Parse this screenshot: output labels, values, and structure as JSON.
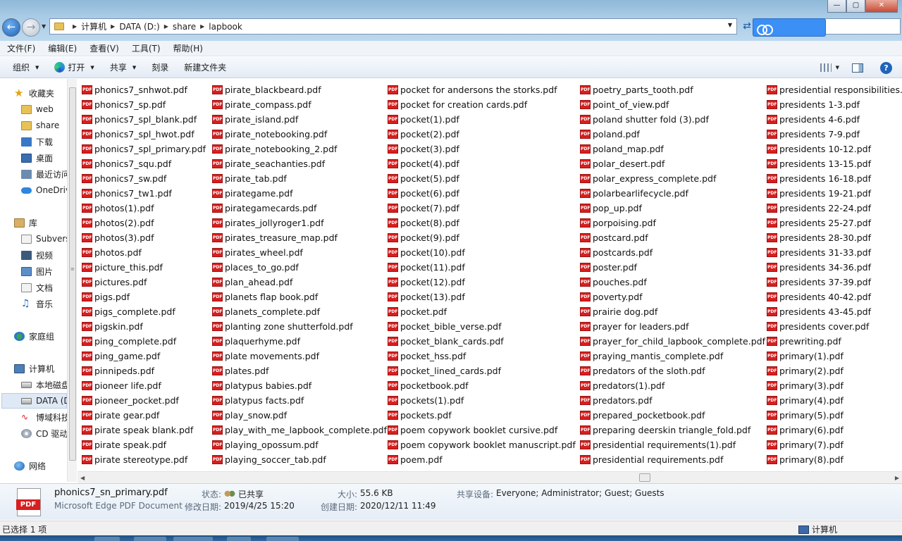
{
  "window": {
    "controls": [
      "—",
      "▢",
      "✕"
    ]
  },
  "address": {
    "crumbs": [
      "计算机",
      "DATA (D:)",
      "share",
      "lapbook"
    ]
  },
  "menu": [
    "文件(F)",
    "编辑(E)",
    "查看(V)",
    "工具(T)",
    "帮助(H)"
  ],
  "toolbar": {
    "organize": "组织",
    "open": "打开",
    "share": "共享",
    "burn": "刻录",
    "new_folder": "新建文件夹"
  },
  "nav": {
    "favorites": "收藏夹",
    "web": "web",
    "share": "share",
    "downloads": "下载",
    "desktop": "桌面",
    "recent": "最近访问",
    "onedrive": "OneDrive",
    "libraries": "库",
    "subversion": "Subversion",
    "videos": "视频",
    "pictures": "图片",
    "documents": "文档",
    "music": "音乐",
    "homegroup": "家庭组",
    "computer": "计算机",
    "local_disk": "本地磁盘",
    "data_drive": "DATA (D:)",
    "bowei": "博域科技",
    "cd_drive": "CD 驱动器",
    "network": "网络"
  },
  "icons": {
    "pdf": "PDF"
  },
  "files": {
    "col1": [
      "phonics7_snhwot.pdf",
      "phonics7_sp.pdf",
      "phonics7_spl_blank.pdf",
      "phonics7_spl_hwot.pdf",
      "phonics7_spl_primary.pdf",
      "phonics7_squ.pdf",
      "phonics7_sw.pdf",
      "phonics7_tw1.pdf",
      "photos(1).pdf",
      "photos(2).pdf",
      "photos(3).pdf",
      "photos.pdf",
      "picture_this.pdf",
      "pictures.pdf",
      "pigs.pdf",
      "pigs_complete.pdf",
      "pigskin.pdf",
      "ping_complete.pdf",
      "ping_game.pdf",
      "pinnipeds.pdf",
      "pioneer life.pdf",
      "pioneer_pocket.pdf",
      "pirate gear.pdf",
      "pirate speak blank.pdf",
      "pirate speak.pdf",
      "pirate stereotype.pdf"
    ],
    "col2": [
      "pirate_blackbeard.pdf",
      "pirate_compass.pdf",
      "pirate_island.pdf",
      "pirate_notebooking.pdf",
      "pirate_notebooking_2.pdf",
      "pirate_seachanties.pdf",
      "pirate_tab.pdf",
      "pirategame.pdf",
      "pirategamecards.pdf",
      "pirates_jollyroger1.pdf",
      "pirates_treasure_map.pdf",
      "pirates_wheel.pdf",
      "places_to_go.pdf",
      "plan_ahead.pdf",
      "planets flap book.pdf",
      "planets_complete.pdf",
      "planting zone shutterfold.pdf",
      "plaquerhyme.pdf",
      "plate movements.pdf",
      "plates.pdf",
      "platypus babies.pdf",
      "platypus facts.pdf",
      "play_snow.pdf",
      "play_with_me_lapbook_complete.pdf",
      "playing_opossum.pdf",
      "playing_soccer_tab.pdf"
    ],
    "col3": [
      "pocket for andersons the storks.pdf",
      "pocket for creation cards.pdf",
      "pocket(1).pdf",
      "pocket(2).pdf",
      "pocket(3).pdf",
      "pocket(4).pdf",
      "pocket(5).pdf",
      "pocket(6).pdf",
      "pocket(7).pdf",
      "pocket(8).pdf",
      "pocket(9).pdf",
      "pocket(10).pdf",
      "pocket(11).pdf",
      "pocket(12).pdf",
      "pocket(13).pdf",
      "pocket.pdf",
      "pocket_bible_verse.pdf",
      "pocket_blank_cards.pdf",
      "pocket_hss.pdf",
      "pocket_lined_cards.pdf",
      "pocketbook.pdf",
      "pockets(1).pdf",
      "pockets.pdf",
      "poem copywork booklet cursive.pdf",
      "poem copywork booklet manuscript.pdf",
      "poem.pdf"
    ],
    "col4": [
      "poetry_parts_tooth.pdf",
      "point_of_view.pdf",
      "poland shutter fold (3).pdf",
      "poland.pdf",
      "poland_map.pdf",
      "polar_desert.pdf",
      "polar_express_complete.pdf",
      "polarbearlifecycle.pdf",
      "pop_up.pdf",
      "porpoising.pdf",
      "postcard.pdf",
      "postcards.pdf",
      "poster.pdf",
      "pouches.pdf",
      "poverty.pdf",
      "prairie dog.pdf",
      "prayer for leaders.pdf",
      "prayer_for_child_lapbook_complete.pdf",
      "praying_mantis_complete.pdf",
      "predators of the sloth.pdf",
      "predators(1).pdf",
      "predators.pdf",
      "prepared_pocketbook.pdf",
      "preparing deerskin triangle_fold.pdf",
      "presidential requirements(1).pdf",
      "presidential requirements.pdf"
    ],
    "col5": [
      "presidential responsibilities.pdf",
      "presidents 1-3.pdf",
      "presidents 4-6.pdf",
      "presidents 7-9.pdf",
      "presidents 10-12.pdf",
      "presidents 13-15.pdf",
      "presidents 16-18.pdf",
      "presidents 19-21.pdf",
      "presidents 22-24.pdf",
      "presidents 25-27.pdf",
      "presidents 28-30.pdf",
      "presidents 31-33.pdf",
      "presidents 34-36.pdf",
      "presidents 37-39.pdf",
      "presidents 40-42.pdf",
      "presidents 43-45.pdf",
      "presidents cover.pdf",
      "prewriting.pdf",
      "primary(1).pdf",
      "primary(2).pdf",
      "primary(3).pdf",
      "primary(4).pdf",
      "primary(5).pdf",
      "primary(6).pdf",
      "primary(7).pdf",
      "primary(8).pdf"
    ]
  },
  "details": {
    "filename": "phonics7_sn_primary.pdf",
    "filetype": "Microsoft Edge PDF Document",
    "status_label": "状态:",
    "status_value": "已共享",
    "modified_label": "修改日期:",
    "modified_value": "2019/4/25 15:20",
    "size_label": "大小:",
    "size_value": "55.6 KB",
    "created_label": "创建日期:",
    "created_value": "2020/12/11 11:49",
    "shared_label": "共享设备:",
    "shared_value": "Everyone; Administrator; Guest; Guests"
  },
  "status": {
    "selection": "已选择 1 项",
    "location": "计算机"
  }
}
